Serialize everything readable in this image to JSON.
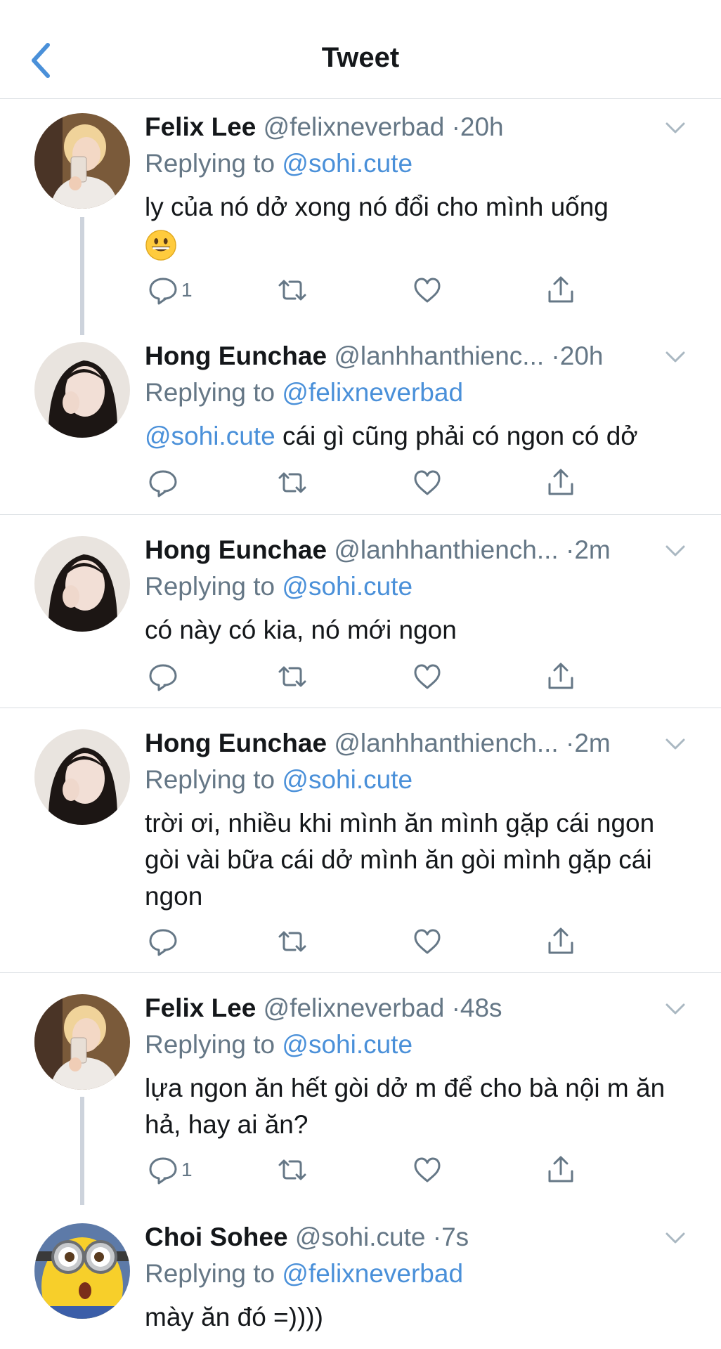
{
  "header": {
    "title": "Tweet"
  },
  "tweets": [
    {
      "name": "Felix Lee",
      "handle": "@felixneverbad",
      "time": "20h",
      "replying_label": "Replying to",
      "replying_to": "@sohi.cute",
      "mention": "",
      "text": "ly của nó dở xong nó đổi cho mình uống",
      "emoji": "grinning-face",
      "reply_count": "1"
    },
    {
      "name": "Hong Eunchae",
      "handle": "@lanhhanthienc...",
      "time": "20h",
      "replying_label": "Replying to",
      "replying_to": "@felixneverbad",
      "mention": "@sohi.cute",
      "text": "cái gì cũng phải có ngon có dở",
      "reply_count": ""
    },
    {
      "name": "Hong Eunchae",
      "handle": "@lanhhanthiench...",
      "time": "2m",
      "replying_label": "Replying to",
      "replying_to": "@sohi.cute",
      "mention": "",
      "text": "có này có kia, nó mới ngon",
      "reply_count": ""
    },
    {
      "name": "Hong Eunchae",
      "handle": "@lanhhanthiench...",
      "time": "2m",
      "replying_label": "Replying to",
      "replying_to": "@sohi.cute",
      "mention": "",
      "text": "trời ơi, nhiều khi mình ăn mình gặp cái ngon gòi vài bữa cái dở mình ăn gòi mình gặp cái ngon",
      "reply_count": ""
    },
    {
      "name": "Felix Lee",
      "handle": "@felixneverbad",
      "time": "48s",
      "replying_label": "Replying to",
      "replying_to": "@sohi.cute",
      "mention": "",
      "text": "lựa ngon ăn hết gòi dở m để cho bà nội m ăn hả, hay ai ăn?",
      "reply_count": "1"
    },
    {
      "name": "Choi Sohee",
      "handle": "@sohi.cute",
      "time": "7s",
      "replying_label": "Replying to",
      "replying_to": "@felixneverbad",
      "mention": "",
      "text": "mày ăn đó =))))",
      "reply_count": ""
    }
  ],
  "dot": "·",
  "colors": {
    "link": "#4a90d9",
    "muted": "#657786",
    "divider": "#d8dde1"
  },
  "icons": [
    "chevron-left-icon",
    "caret-down-icon",
    "reply-icon",
    "retweet-icon",
    "like-icon",
    "share-icon"
  ]
}
